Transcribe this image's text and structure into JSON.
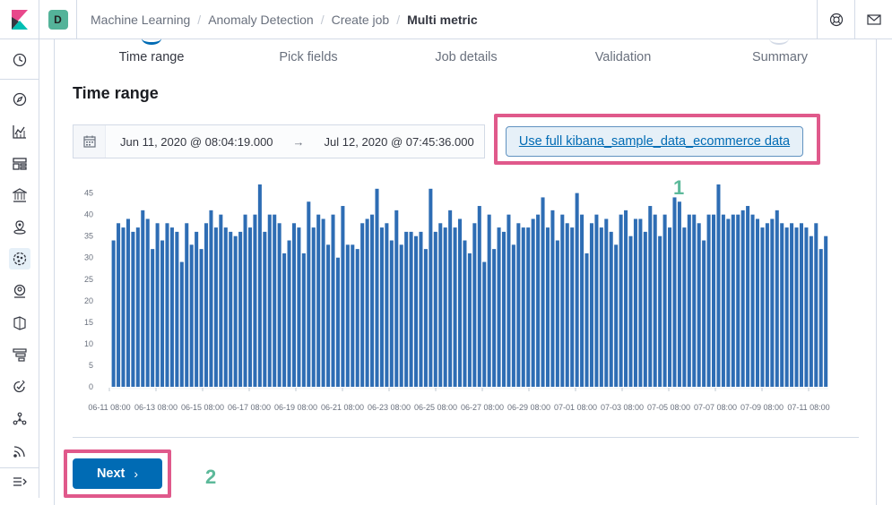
{
  "topbar": {
    "space_initial": "D",
    "breadcrumbs": [
      "Machine Learning",
      "Anomaly Detection",
      "Create job",
      "Multi metric"
    ],
    "icons": [
      "help-icon",
      "mail-icon"
    ]
  },
  "sidenav": {
    "icons": [
      "clock-icon",
      "compass-icon",
      "visualize-icon",
      "dashboard-icon",
      "canvas-icon",
      "maps-icon",
      "ml-icon",
      "infra-icon",
      "logs-icon",
      "apm-icon",
      "uptime-icon",
      "graph-icon",
      "stack-monitoring-icon",
      "dock-icon"
    ]
  },
  "steps": [
    {
      "label": "Time range",
      "active": true
    },
    {
      "label": "Pick fields",
      "active": false
    },
    {
      "label": "Job details",
      "active": false
    },
    {
      "label": "Validation",
      "active": false
    },
    {
      "label": "Summary",
      "active": false
    }
  ],
  "section_title": "Time range",
  "datepicker": {
    "start": "Jun 11, 2020 @ 08:04:19.000",
    "arrow": "→",
    "end": "Jul 12, 2020 @ 07:45:36.000"
  },
  "full_data_button": "Use full kibana_sample_data_ecommerce data",
  "annotations": {
    "one": "1",
    "two": "2"
  },
  "next_button": "Next",
  "colors": {
    "bar": "#2e6db4",
    "primary": "#006bb4",
    "highlight": "#e0598b",
    "annotation": "#5cb99a"
  },
  "chart_data": {
    "type": "bar",
    "ylim": [
      0,
      47
    ],
    "yticks": [
      0,
      5,
      10,
      15,
      20,
      25,
      30,
      35,
      40,
      45
    ],
    "xticks": [
      "06-11 08:00",
      "06-13 08:00",
      "06-15 08:00",
      "06-17 08:00",
      "06-19 08:00",
      "06-21 08:00",
      "06-23 08:00",
      "06-25 08:00",
      "06-27 08:00",
      "06-29 08:00",
      "07-01 08:00",
      "07-03 08:00",
      "07-05 08:00",
      "07-07 08:00",
      "07-09 08:00",
      "07-11 08:00"
    ],
    "values": [
      34,
      38,
      37,
      39,
      36,
      37,
      41,
      39,
      32,
      38,
      34,
      38,
      37,
      36,
      29,
      38,
      33,
      36,
      32,
      38,
      41,
      37,
      40,
      37,
      36,
      35,
      36,
      40,
      37,
      40,
      47,
      36,
      40,
      40,
      38,
      31,
      34,
      38,
      37,
      31,
      43,
      37,
      40,
      39,
      33,
      40,
      30,
      42,
      33,
      33,
      32,
      38,
      39,
      40,
      46,
      37,
      38,
      34,
      41,
      33,
      36,
      36,
      35,
      36,
      32,
      46,
      36,
      38,
      37,
      41,
      37,
      39,
      34,
      31,
      38,
      42,
      29,
      40,
      32,
      37,
      36,
      40,
      33,
      38,
      37,
      37,
      39,
      40,
      44,
      37,
      41,
      34,
      40,
      38,
      37,
      45,
      40,
      31,
      38,
      40,
      37,
      39,
      36,
      33,
      40,
      41,
      35,
      39,
      39,
      36,
      42,
      40,
      35,
      40,
      37,
      44,
      43,
      37,
      40,
      40,
      38,
      34,
      40,
      40,
      47,
      40,
      39,
      40,
      40,
      41,
      42,
      40,
      39,
      37,
      38,
      39,
      41,
      38,
      37,
      38,
      37,
      38,
      37,
      35,
      38,
      32,
      35
    ]
  }
}
